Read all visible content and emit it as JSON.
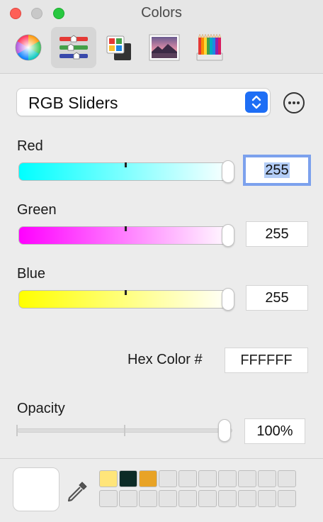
{
  "window": {
    "title": "Colors"
  },
  "toolbar": {
    "tabs": [
      {
        "name": "color-wheel",
        "icon": "color-wheel-icon",
        "active": false
      },
      {
        "name": "color-sliders",
        "icon": "sliders-icon",
        "active": true
      },
      {
        "name": "color-palettes",
        "icon": "palettes-icon",
        "active": false
      },
      {
        "name": "image-palettes",
        "icon": "image-icon",
        "active": false
      },
      {
        "name": "pencils",
        "icon": "pencils-icon",
        "active": false
      }
    ]
  },
  "mode_popup": {
    "selected": "RGB Sliders",
    "icon": "up-down-chevron-icon"
  },
  "more_button": {
    "icon": "ellipsis-circle-icon"
  },
  "sliders": [
    {
      "label": "Red",
      "value": "255",
      "level": 1.0,
      "gradient_from": "#00ffff",
      "gradient_to": "#ffffff"
    },
    {
      "label": "Green",
      "value": "255",
      "level": 1.0,
      "gradient_from": "#ff00ff",
      "gradient_to": "#ffffff"
    },
    {
      "label": "Blue",
      "value": "255",
      "level": 1.0,
      "gradient_from": "#ffff00",
      "gradient_to": "#ffffff"
    }
  ],
  "hex": {
    "label": "Hex Color #",
    "value": "FFFFFF"
  },
  "opacity": {
    "label": "Opacity",
    "value": "100%",
    "level": 1.0
  },
  "current_color": "#ffffff",
  "saved_swatches": [
    "#ffe57a",
    "#0c2b26",
    "#e8a326"
  ],
  "colors": {
    "accent": "#1e6ef5",
    "focus_ring": "#7ca1ed",
    "selection": "#b3cdf7"
  }
}
